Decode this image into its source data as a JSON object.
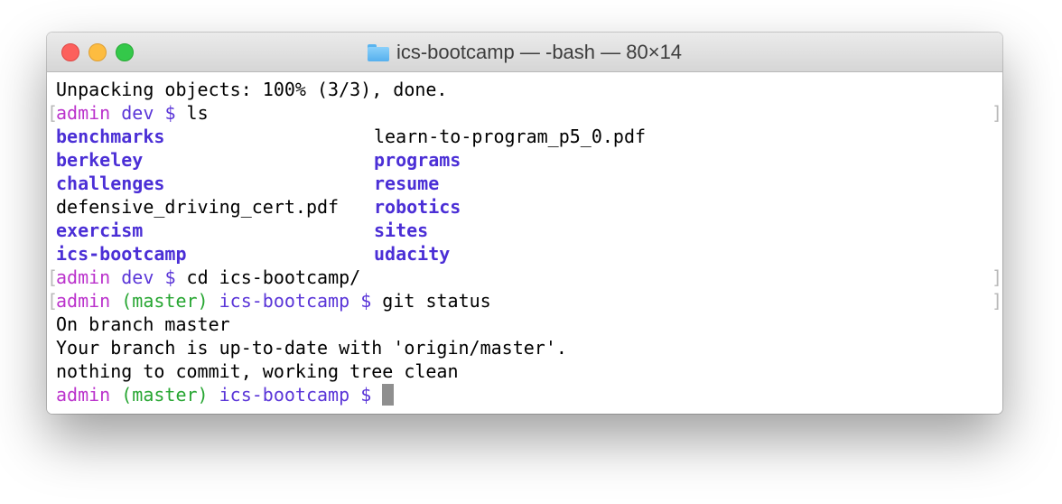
{
  "window": {
    "title": "ics-bootcamp — -bash — 80×14",
    "icon": "folder-icon"
  },
  "terminal": {
    "line1": "Unpacking objects: 100% (3/3), done.",
    "prompt1": {
      "user": "admin",
      "path": "dev",
      "symbol": "$",
      "command": "ls"
    },
    "ls_left": [
      "benchmarks",
      "berkeley",
      "challenges",
      "defensive_driving_cert.pdf",
      "exercism",
      "ics-bootcamp"
    ],
    "ls_right": [
      "learn-to-program_p5_0.pdf",
      "programs",
      "resume",
      "robotics",
      "sites",
      "udacity"
    ],
    "prompt2": {
      "user": "admin",
      "path": "dev",
      "symbol": "$",
      "command": "cd ics-bootcamp/"
    },
    "prompt3": {
      "user": "admin",
      "branch": "(master)",
      "path": "ics-bootcamp",
      "symbol": "$",
      "command": "git status"
    },
    "output1": "On branch master",
    "output2": "Your branch is up-to-date with 'origin/master'.",
    "output3": "nothing to commit, working tree clean",
    "prompt4": {
      "user": "admin",
      "branch": "(master)",
      "path": "ics-bootcamp",
      "symbol": "$"
    },
    "mark_left": "[",
    "mark_right": "]"
  },
  "colors": {
    "user": "#bb33cc",
    "branch": "#27a632",
    "directory": "#4b2fd6",
    "close": "#fc605c",
    "minimize": "#fdbc40",
    "maximize": "#34c84a"
  }
}
